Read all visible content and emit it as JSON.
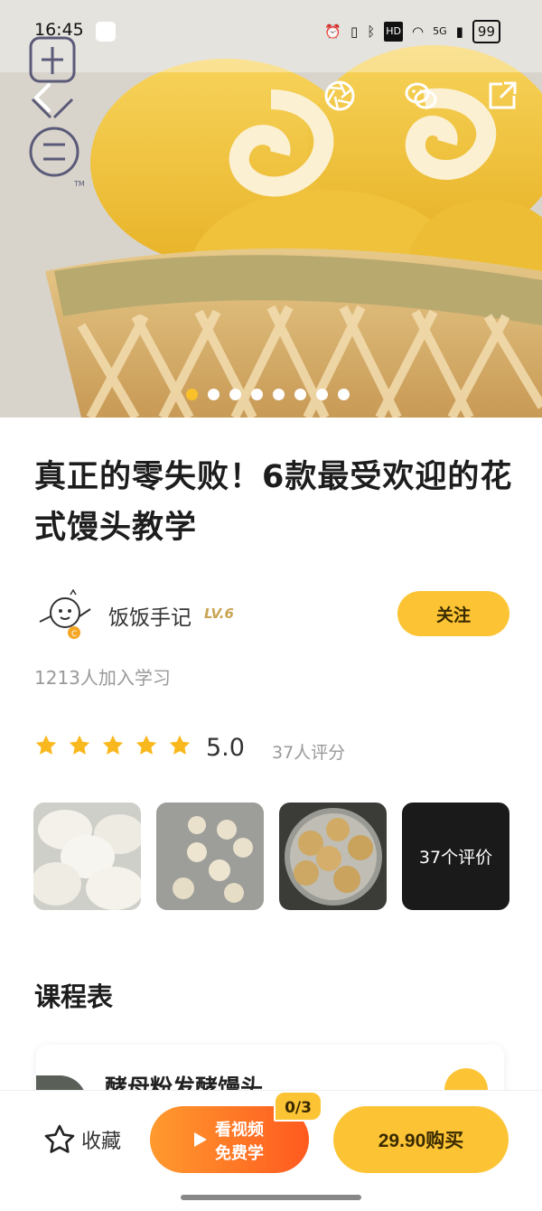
{
  "status_bar": {
    "time": "16:45",
    "battery": "99",
    "network": "5G",
    "icons": [
      "alarm-icon",
      "vibrate-icon",
      "bluetooth-icon",
      "hd-icon",
      "wifi-icon",
      "signal-icon"
    ]
  },
  "hero": {
    "dots_count": 8,
    "active_dot": 0,
    "actions": [
      "shutter-icon",
      "wechat-icon",
      "share-icon"
    ]
  },
  "course": {
    "title": "真正的零失败！6款最受欢迎的花式馒头教学",
    "author_name": "饭饭手记",
    "author_level": "LV.6",
    "follow_label": "关注",
    "learners": "1213人加入学习",
    "rating": {
      "stars": 5,
      "score": "5.0",
      "count_label": "37人评分"
    },
    "reviews_more_label": "37个评价"
  },
  "schedule": {
    "section_title": "课程表",
    "lessons": [
      {
        "title": "酵母粉发酵馒头"
      }
    ]
  },
  "bottom_bar": {
    "favorite_label": "收藏",
    "video_line1": "看视频",
    "video_line2": "免费学",
    "quota": "0/3",
    "buy_label": "29.90购买"
  },
  "colors": {
    "accent": "#fcc435",
    "video_gradient_start": "#ff9a2e",
    "video_gradient_end": "#ff5a1f",
    "star": "#f9b81e"
  }
}
